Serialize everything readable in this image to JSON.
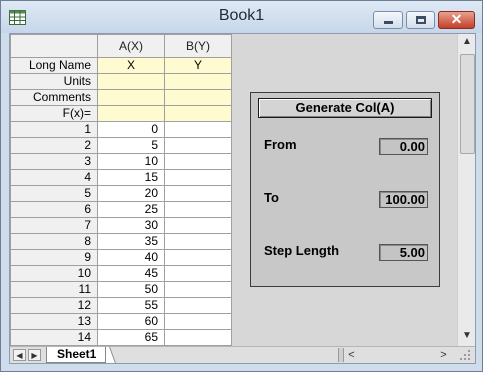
{
  "window": {
    "title": "Book1",
    "minimize_icon": "minimize-icon",
    "maximize_icon": "maximize-icon",
    "close_icon": "close-icon",
    "close_glyph": "✕"
  },
  "columns": [
    {
      "header": "A(X)",
      "long_name": "X"
    },
    {
      "header": "B(Y)",
      "long_name": "Y"
    }
  ],
  "meta_rows": [
    "Long Name",
    "Units",
    "Comments",
    "F(x)="
  ],
  "rows": [
    {
      "num": "1",
      "a": "0"
    },
    {
      "num": "2",
      "a": "5"
    },
    {
      "num": "3",
      "a": "10"
    },
    {
      "num": "4",
      "a": "15"
    },
    {
      "num": "5",
      "a": "20"
    },
    {
      "num": "6",
      "a": "25"
    },
    {
      "num": "7",
      "a": "30"
    },
    {
      "num": "8",
      "a": "35"
    },
    {
      "num": "9",
      "a": "40"
    },
    {
      "num": "10",
      "a": "45"
    },
    {
      "num": "11",
      "a": "50"
    },
    {
      "num": "12",
      "a": "55"
    },
    {
      "num": "13",
      "a": "60"
    },
    {
      "num": "14",
      "a": "65"
    }
  ],
  "panel": {
    "button_label": "Generate Col(A)",
    "from_label": "From",
    "from_value": "0.00",
    "to_label": "To",
    "to_value": "100.00",
    "step_label": "Step Length",
    "step_value": "5.00"
  },
  "sheet_tab": "Sheet1",
  "nav": {
    "prev": "◀",
    "next": "▶"
  },
  "scroll": {
    "up": "▲",
    "down": "▼",
    "left": "<",
    "right": ">"
  }
}
